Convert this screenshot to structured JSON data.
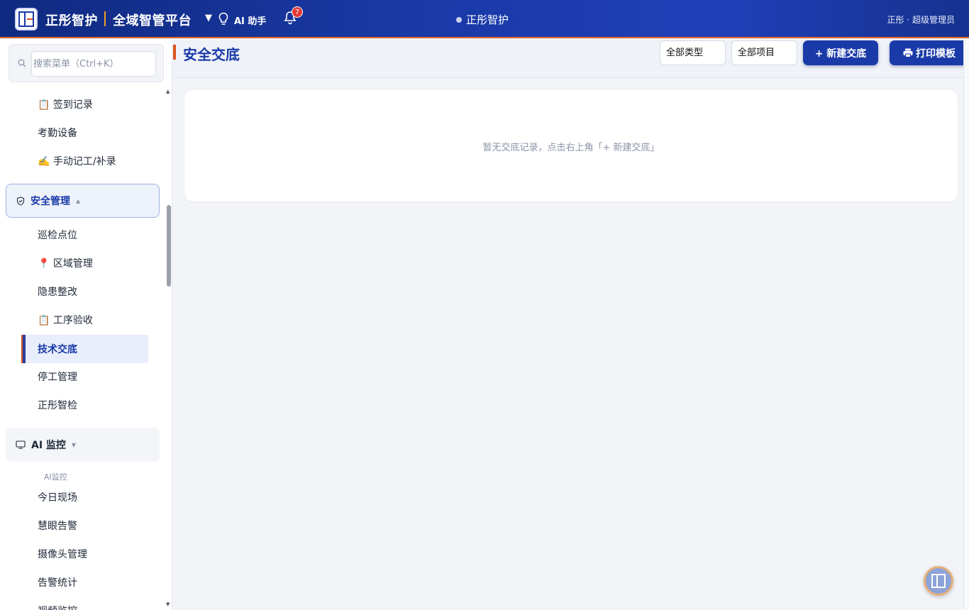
{
  "topbar": {
    "brand": "正彤智护",
    "platform": "全域智管平台",
    "caret": "▼",
    "ai_assistant": "AI 助手",
    "notification_count": "7",
    "center_title": "正彤智护",
    "user": "正彤 · 超级管理员"
  },
  "sidebar": {
    "search_placeholder": "搜索菜单（Ctrl+K）",
    "items_top": [
      {
        "label": "📋 签到记录"
      },
      {
        "label": "考勤设备"
      },
      {
        "label": "✍️ 手动记工/补录"
      }
    ],
    "safety_group": {
      "label": "安全管理",
      "caret": "▲"
    },
    "safety_items": [
      {
        "label": "巡检点位"
      },
      {
        "label": "📍 区域管理"
      },
      {
        "label": "隐患整改"
      },
      {
        "label": "📋 工序验收"
      },
      {
        "label": "技术交底"
      },
      {
        "label": "停工管理"
      },
      {
        "label": "正彤智检"
      }
    ],
    "ai_group": {
      "label": "AI 监控",
      "caret": "▼"
    },
    "ai_sub_label": "AI监控",
    "ai_items": [
      {
        "label": "今日现场"
      },
      {
        "label": "慧眼告警"
      },
      {
        "label": "摄像头管理"
      },
      {
        "label": "告警统计"
      },
      {
        "label": "视频监控"
      }
    ],
    "scroll_up": "▲",
    "scroll_down": "▼"
  },
  "main": {
    "title": "安全交底",
    "filter_type": "全部类型",
    "filter_project": "全部项目",
    "new_button": "+ 新建交底",
    "print_button": "打印模板",
    "empty_message": "暂无交底记录，点击右上角「+ 新建交底」"
  },
  "colors": {
    "brand_blue": "#1a3aa8",
    "accent_orange": "#d9531e",
    "badge_red": "#e53935"
  }
}
